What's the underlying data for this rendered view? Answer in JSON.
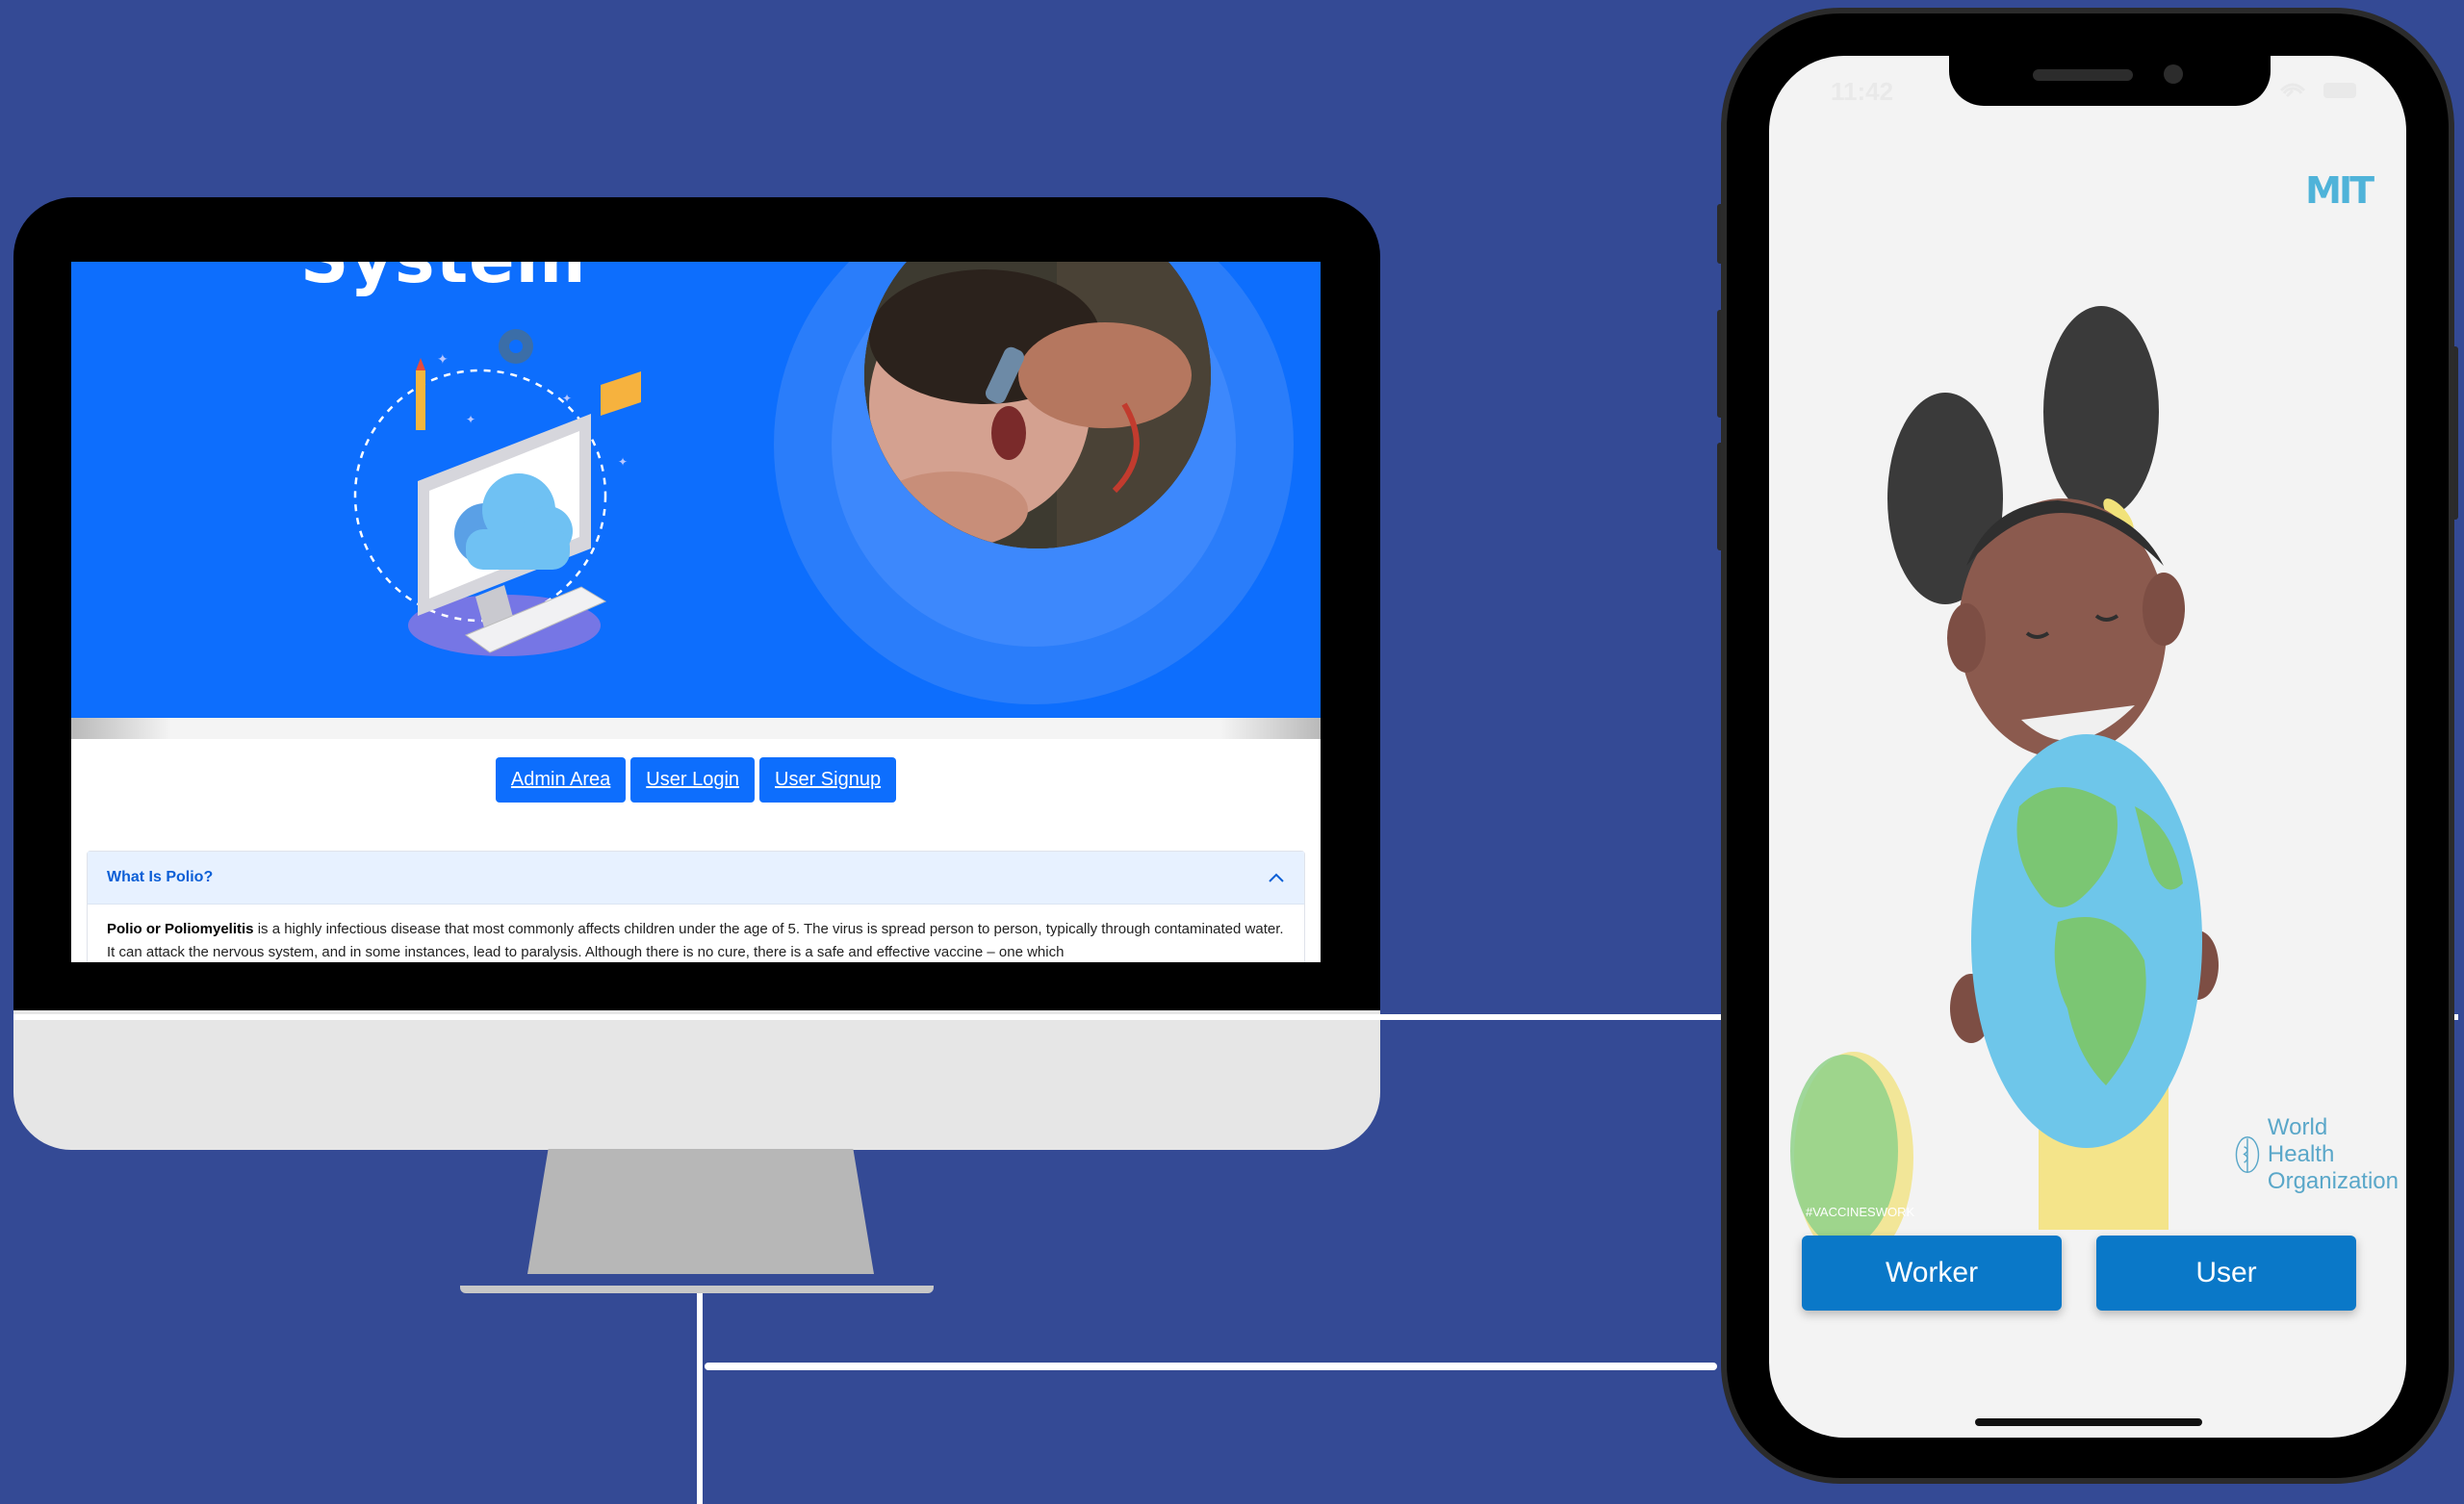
{
  "desktop": {
    "hero_title_fragment": "System",
    "nav": {
      "admin_area": "Admin Area",
      "user_login": "User Login",
      "user_signup": "User Signup"
    },
    "accordion": {
      "header": "What Is Polio?",
      "body_bold": "Polio or Poliomyelitis",
      "body_text": " is a highly infectious disease that most commonly affects children under the age of 5. The virus is spread person to person, typically through contaminated water. It can attack the nervous system, and in some instances, lead to paralysis. Although there is no cure, there is a safe and effective vaccine – one which"
    },
    "colors": {
      "hero": "#0d6efd",
      "accordion_header": "#e7f1ff"
    }
  },
  "phone": {
    "status_time": "11:42",
    "app_logo": "MIT",
    "badge_text": "#VACCINESWORK",
    "who_line1": "World Health",
    "who_line2": "Organization",
    "buttons": {
      "worker": "Worker",
      "user": "User"
    },
    "colors": {
      "button": "#0a78c8",
      "background": "#f3f3f3"
    }
  },
  "background_color": "#344a95"
}
